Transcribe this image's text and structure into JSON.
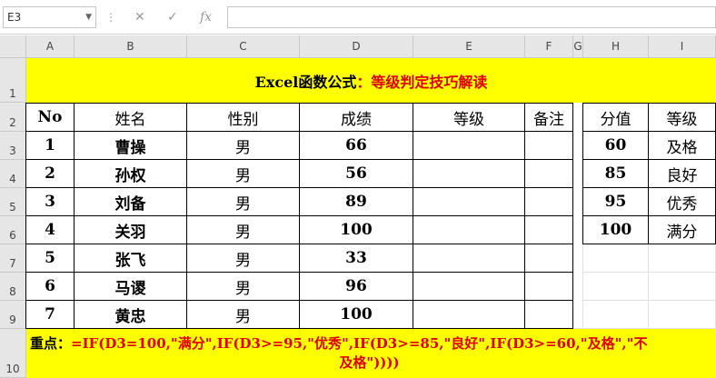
{
  "namebox": "E3",
  "formula_bar": {
    "cancel_icon": "✕",
    "enter_icon": "✓",
    "fx_label": "fx",
    "value": ""
  },
  "columns": [
    "A",
    "B",
    "C",
    "D",
    "E",
    "F",
    "G",
    "H",
    "I"
  ],
  "rows": [
    "1",
    "2",
    "3",
    "4",
    "5",
    "6",
    "7",
    "8",
    "9",
    "10"
  ],
  "title": {
    "part1": "Excel函数公式",
    "part2": "：等级判定技巧解读"
  },
  "main_table": {
    "headers": [
      "No",
      "姓名",
      "性别",
      "成绩",
      "等级",
      "备注"
    ],
    "rows": [
      [
        "1",
        "曹操",
        "男",
        "66",
        "",
        ""
      ],
      [
        "2",
        "孙权",
        "男",
        "56",
        "",
        ""
      ],
      [
        "3",
        "刘备",
        "男",
        "89",
        "",
        ""
      ],
      [
        "4",
        "关羽",
        "男",
        "100",
        "",
        ""
      ],
      [
        "5",
        "张飞",
        "男",
        "33",
        "",
        ""
      ],
      [
        "6",
        "马谡",
        "男",
        "96",
        "",
        ""
      ],
      [
        "7",
        "黄忠",
        "男",
        "100",
        "",
        ""
      ]
    ]
  },
  "lookup_table": {
    "headers": [
      "分值",
      "等级"
    ],
    "rows": [
      [
        "60",
        "及格"
      ],
      [
        "85",
        "良好"
      ],
      [
        "95",
        "优秀"
      ],
      [
        "100",
        "满分"
      ]
    ]
  },
  "note": {
    "label": "重点：",
    "line1": "=IF(D3=100,\"满分\",IF(D3>=95,\"优秀\",IF(D3>=85,\"良好\",IF(D3>=60,\"及格\",\"不",
    "line2": "及格\"))))"
  }
}
